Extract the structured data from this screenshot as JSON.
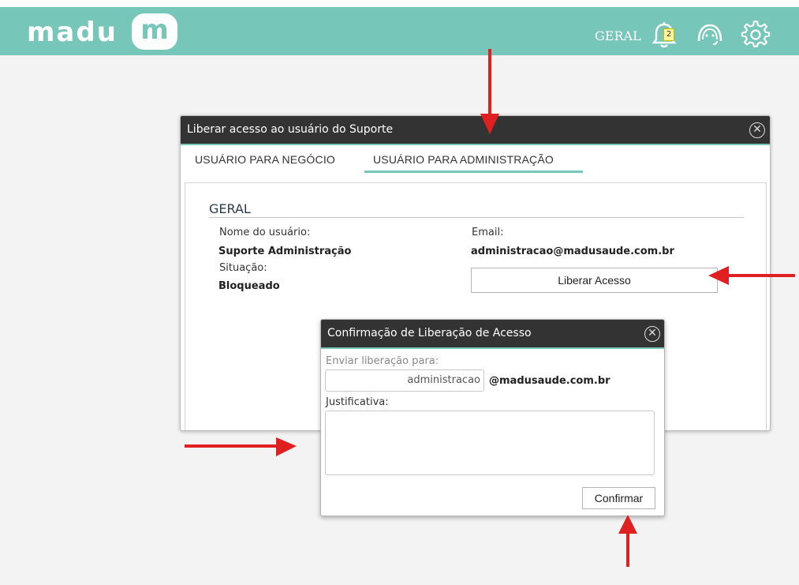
{
  "topbar": {
    "brand_text": "madu",
    "brand_mark": "m",
    "geral_label": "GERAL",
    "notification_count": "2",
    "icons": [
      "bell-icon",
      "support-headset-icon",
      "gear-icon"
    ],
    "bg_color": "#76c6b9"
  },
  "dialog": {
    "title": "Liberar acesso ao usuário do Suporte",
    "tabs": [
      {
        "label": "USUÁRIO PARA NEGÓCIO",
        "active": false
      },
      {
        "label": "USUÁRIO PARA ADMINISTRAÇÃO",
        "active": true
      }
    ],
    "section_title": "GERAL",
    "fields": {
      "user_name_label": "Nome do usuário:",
      "user_name_value": "Suporte Administração",
      "status_label": "Situação:",
      "status_value": "Bloqueado",
      "email_label": "Email:",
      "email_value": "administracao@madusaude.com.br"
    },
    "release_button": "Liberar Acesso"
  },
  "confirm_dialog": {
    "title": "Confirmação de Liberação de Acesso",
    "send_to_label": "Enviar liberação para:",
    "send_to_value": "administracao",
    "domain_suffix": "@madusaude.com.br",
    "justification_label": "Justificativa:",
    "justification_value": "",
    "confirm_button": "Confirmar"
  },
  "colors": {
    "accent": "#76c6b9",
    "header_dark": "#333333",
    "annotation_arrow": "#e02020"
  }
}
